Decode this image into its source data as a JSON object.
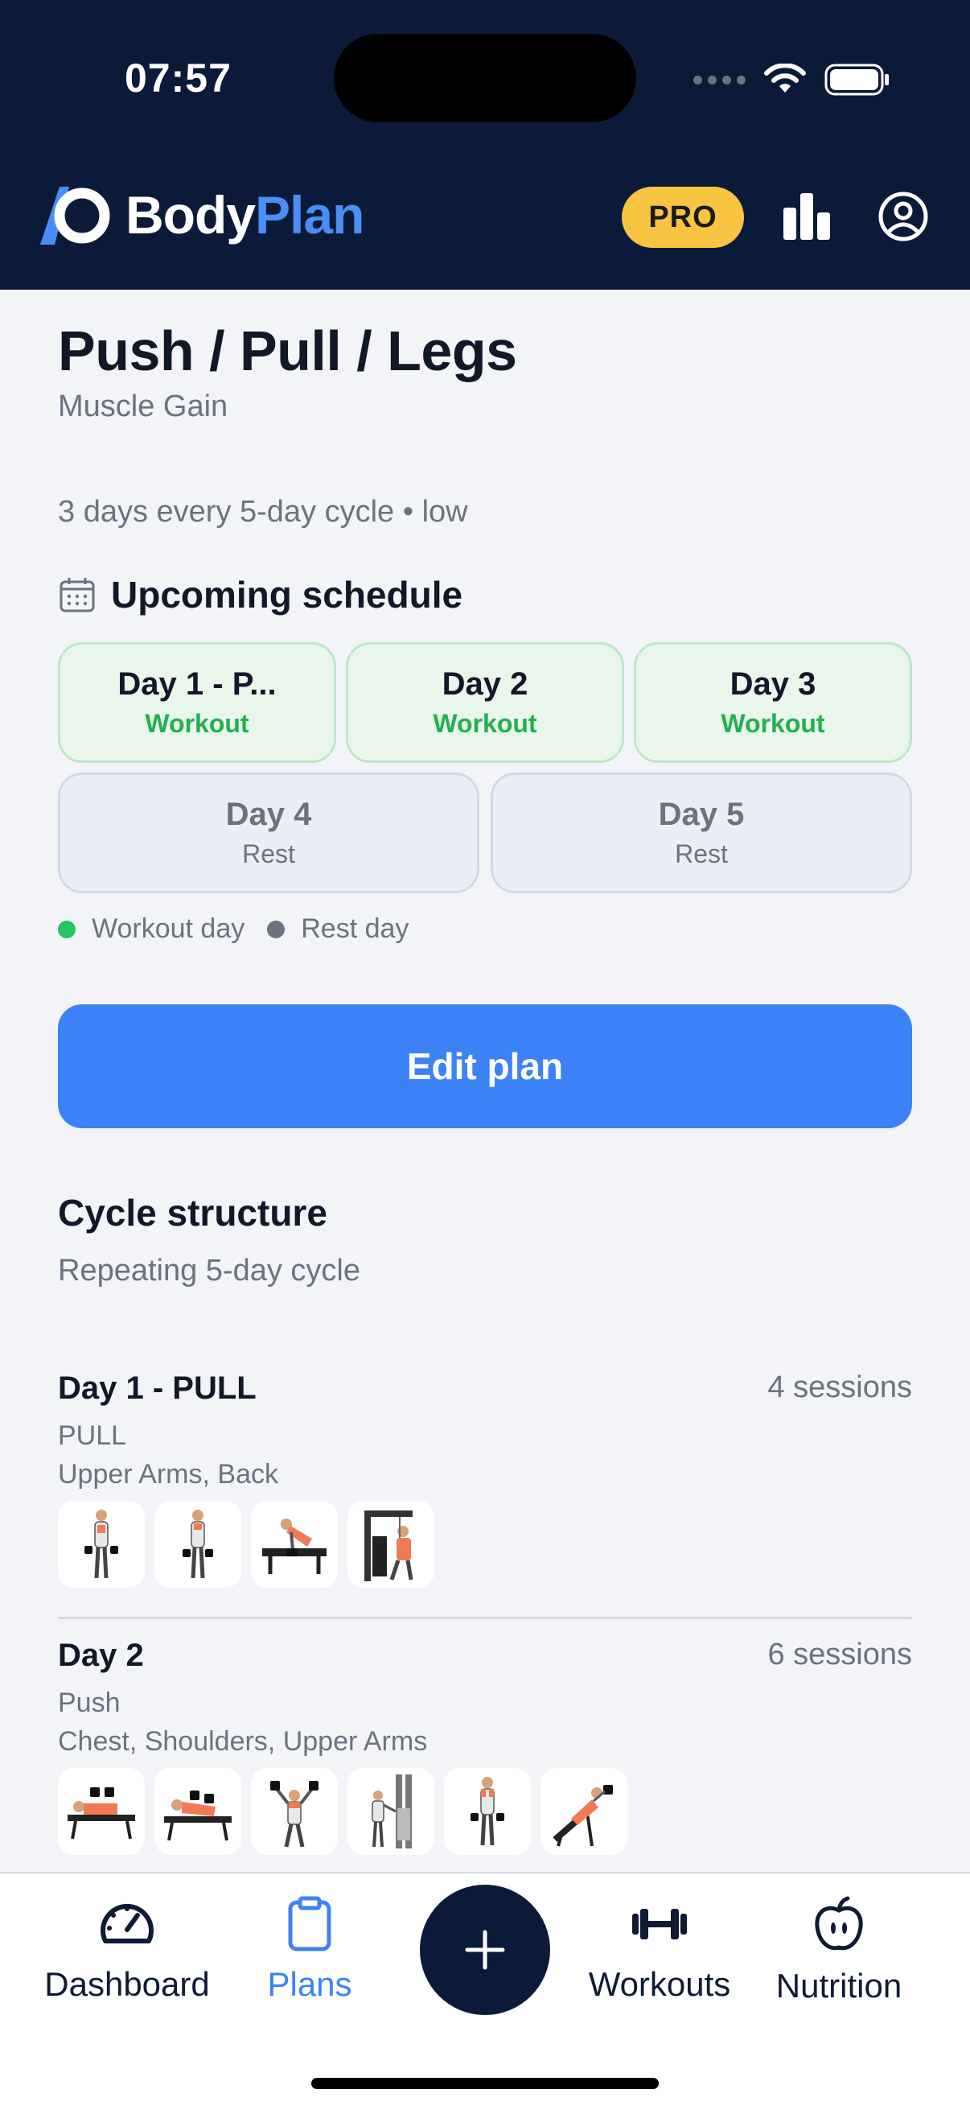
{
  "status_bar": {
    "time": "07:57"
  },
  "app": {
    "logo_part1": "Body",
    "logo_part2": "Plan",
    "pro_badge": "PRO"
  },
  "plan": {
    "title": "Push / Pull / Legs",
    "goal": "Muscle Gain",
    "meta": "3 days every 5-day cycle • low"
  },
  "schedule": {
    "title": "Upcoming schedule",
    "days": [
      {
        "name": "Day 1 - P...",
        "type": "Workout"
      },
      {
        "name": "Day 2",
        "type": "Workout"
      },
      {
        "name": "Day 3",
        "type": "Workout"
      },
      {
        "name": "Day 4",
        "type": "Rest"
      },
      {
        "name": "Day 5",
        "type": "Rest"
      }
    ],
    "legend_workout": "Workout day",
    "legend_rest": "Rest day"
  },
  "edit_button": "Edit plan",
  "cycle": {
    "title": "Cycle structure",
    "subtitle": "Repeating 5-day cycle",
    "days": [
      {
        "title": "Day 1 - PULL",
        "sessions": "4 sessions",
        "split": "PULL",
        "muscles": "Upper Arms, Back"
      },
      {
        "title": "Day 2",
        "sessions": "6 sessions",
        "split": "Push",
        "muscles": "Chest, Shoulders, Upper Arms"
      }
    ]
  },
  "nav": {
    "dashboard": "Dashboard",
    "plans": "Plans",
    "workouts": "Workouts",
    "nutrition": "Nutrition"
  },
  "colors": {
    "header_bg": "#0C1A3A",
    "accent": "#3C82F6",
    "pro": "#F9C440",
    "workout_green": "#22B14C"
  }
}
